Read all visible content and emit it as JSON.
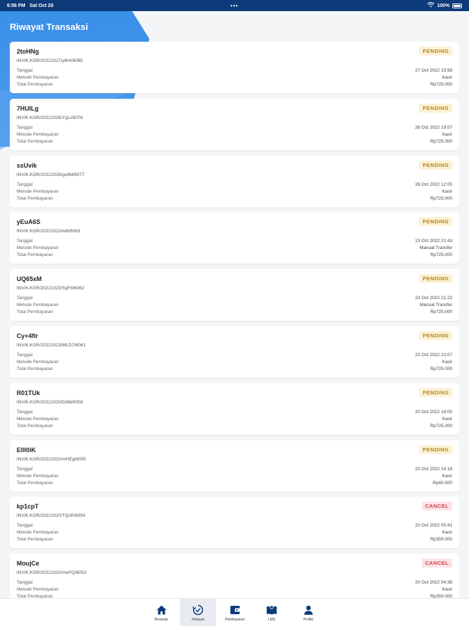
{
  "status_bar": {
    "time": "6:56 PM",
    "date": "Sat Oct 29",
    "dots": "•••",
    "battery": "100%"
  },
  "header": {
    "title": "Riwayat Transaksi"
  },
  "labels": {
    "tanggal": "Tanggal",
    "metode": "Metode Pembayaran",
    "total": "Total Pembayaran"
  },
  "colors": {
    "primary": "#0d3b7a",
    "accent": "#3a8fe8",
    "pending_bg": "#fdf1d4",
    "pending_fg": "#b38717",
    "cancel_bg": "#fde3e6",
    "cancel_fg": "#c7454f"
  },
  "transactions": [
    {
      "code": "2toHNg",
      "invoice": "INV/K.KGR/20221027/y8HI/6085",
      "status": "PENDING",
      "tanggal": "27 Oct 2022 15:58",
      "metode": "Kasir",
      "total": "Rp725.000"
    },
    {
      "code": "7HUILg",
      "invoice": "INV/K.KGR/20221026/YgLI/6078",
      "status": "PENDING",
      "tanggal": "26 Oct 2022 19:07",
      "metode": "Kasir",
      "total": "Rp725.000"
    },
    {
      "code": "ssUvik",
      "invoice": "INV/K.KGR/20221026/gv8M/6077",
      "status": "PENDING",
      "tanggal": "26 Oct 2022 12:05",
      "metode": "Kasir",
      "total": "Rp725.000"
    },
    {
      "code": "yEuA6S",
      "invoice": "INV/K.KGR/20221023/lvl8/6063",
      "status": "PENDING",
      "tanggal": "23 Oct 2022 21:43",
      "metode": "Manual Transfer",
      "total": "Rp725.000"
    },
    {
      "code": "UQ65xM",
      "invoice": "INV/K.KGR/20221023/SgF8/6062",
      "status": "PENDING",
      "tanggal": "23 Oct 2022 21:22",
      "metode": "Manual Transfer",
      "total": "Rp725.000"
    },
    {
      "code": "Cy+4flr",
      "invoice": "INV/K.KGR/20221023/MLD7/6061",
      "status": "PENDING",
      "tanggal": "23 Oct 2022 21:07",
      "metode": "Kasir",
      "total": "Rp725.000"
    },
    {
      "code": "R01TUk",
      "invoice": "INV/K.KGR/20221020/D/88/6056",
      "status": "PENDING",
      "tanggal": "20 Oct 2022 18:05",
      "metode": "Kasir",
      "total": "Rp725.000"
    },
    {
      "code": "E0l0iK",
      "invoice": "INV/K.KGR/20221020/mHEg/6055",
      "status": "PENDING",
      "tanggal": "20 Oct 2022 14:18",
      "metode": "Kasir",
      "total": "Rp40.000"
    },
    {
      "code": "kp1cpT",
      "invoice": "INV/K.KGR/20221020/TQcR/6054",
      "status": "CANCEL",
      "tanggal": "20 Oct 2022 05:41",
      "metode": "Kasir",
      "total": "Rp350.000"
    },
    {
      "code": "MoujCe",
      "invoice": "INV/K.KGR/20221020/mePQ/6053",
      "status": "CANCEL",
      "tanggal": "20 Oct 2022 04:38",
      "metode": "Kasir",
      "total": "Rp350.000"
    }
  ],
  "nav": [
    {
      "label": "Beranda",
      "icon": "home-icon"
    },
    {
      "label": "Riwayat",
      "icon": "history-icon",
      "active": true
    },
    {
      "label": "Pembayaran",
      "icon": "wallet-icon"
    },
    {
      "label": "LMS",
      "icon": "book-icon"
    },
    {
      "label": "Profile",
      "icon": "user-icon"
    }
  ]
}
